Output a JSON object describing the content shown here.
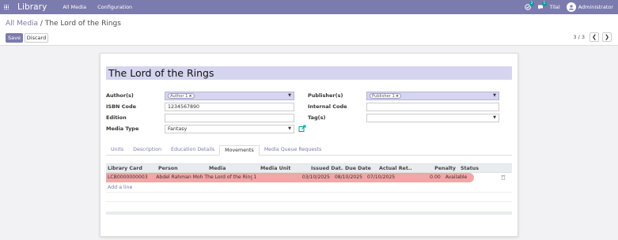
{
  "navbar": {
    "brand": "Library",
    "menus": [
      "All Media",
      "Configuration"
    ],
    "activity_count": "2",
    "messages_count": "1",
    "company": "Tilal",
    "user": "Administrator"
  },
  "breadcrumb": {
    "parent": "All Media",
    "separator": " / ",
    "current": "The Lord of the Rings"
  },
  "buttons": {
    "save": "Save",
    "discard": "Discard"
  },
  "pager": {
    "value": "3 / 3",
    "prev": "❮",
    "next": "❯"
  },
  "form": {
    "title": "The Lord of the Rings",
    "authors_label": "Author(s)",
    "authors": [
      "Author 1"
    ],
    "isbn_label": "ISBN Code",
    "isbn": "1234567890",
    "edition_label": "Edition",
    "edition": "",
    "media_type_label": "Media Type",
    "media_type": "Fantasy",
    "publishers_label": "Publisher(s)",
    "publishers": [
      "Publisher 1"
    ],
    "internal_code_label": "Internal Code",
    "internal_code": "",
    "tags_label": "Tag(s)",
    "tags": ""
  },
  "tabs": [
    "Units",
    "Description",
    "Education Details",
    "Movements",
    "Media Queue Requests"
  ],
  "active_tab": "Movements",
  "table": {
    "headers": [
      "Library Card",
      "Person",
      "Media",
      "Media Unit",
      "Issued Dat...",
      "Due Date",
      "Actual Ret...",
      "Penalty",
      "Status"
    ],
    "rows": [
      [
        "LCB0000000003",
        "Abdel Rahman Moh...",
        "The Lord of the Rings",
        "1",
        "03/10/2025",
        "08/10/2025",
        "07/10/2025",
        "0.00",
        "Available"
      ]
    ],
    "add_line": "Add a line"
  },
  "colors": {
    "brand": "#7c7bad",
    "required_field": "#d5d5ef",
    "late_row": "#f3a6a6",
    "badge": "#00a09d"
  },
  "icons": [
    "apps-icon",
    "activity-icon",
    "messages-icon",
    "external-link-icon",
    "trash-icon",
    "caret-down-icon",
    "remove-tag-icon"
  ]
}
